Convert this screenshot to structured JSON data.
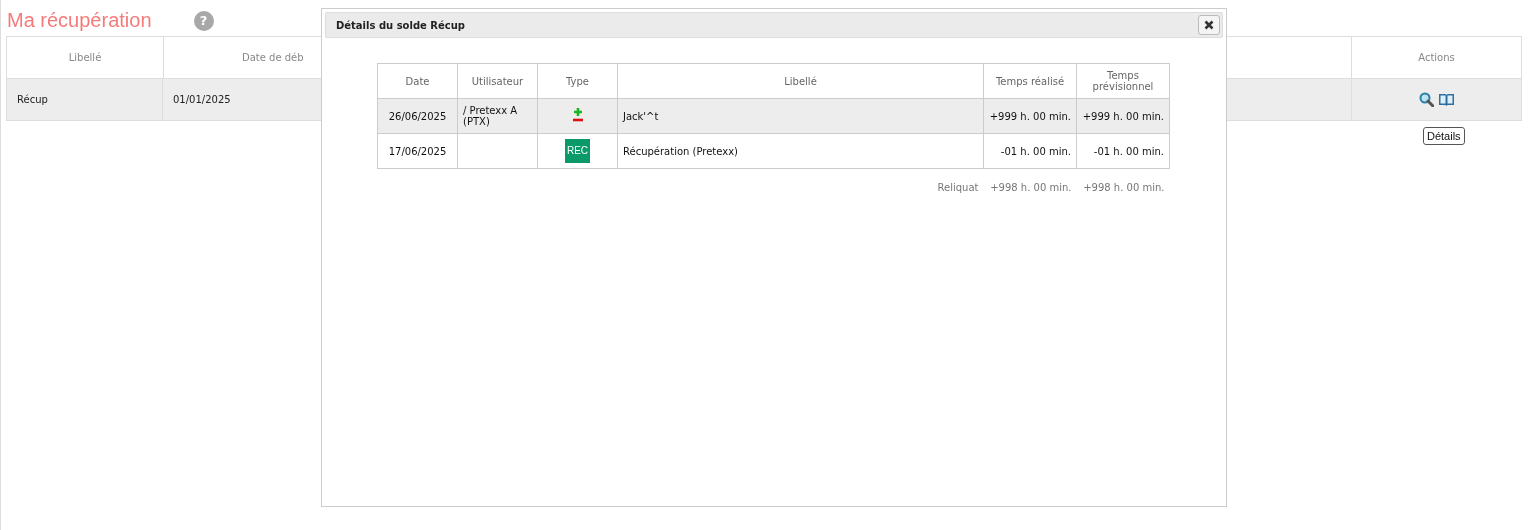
{
  "page": {
    "title": "Ma récupération",
    "help": "?"
  },
  "table": {
    "columns": [
      "Libellé",
      "Date de déb",
      "Actions"
    ],
    "rows": [
      {
        "label": "Récup",
        "date": "01/01/2025",
        "highlighted": true,
        "tooltip": "Détails"
      }
    ]
  },
  "dialog": {
    "title": "Détails du solde Récup",
    "columns": [
      "Date",
      "Utilisateur",
      "Type",
      "Libellé",
      "Temps réalisé",
      "Temps prévisionnel"
    ],
    "rows": [
      {
        "date": "26/06/2025",
        "user": "/ Pretexx A (PTX)",
        "type": {
          "kind": "plusminus"
        },
        "label": "Jack'^t",
        "done": "+999 h. 00 min.",
        "planned": "+999 h. 00 min.",
        "highlighted": true
      },
      {
        "date": "17/06/2025",
        "type": {
          "kind": "badge",
          "text": "REC"
        },
        "label": "Récupération (Pretexx)",
        "done": "-01 h. 00 min.",
        "planned": "-01 h. 00 min.",
        "highlighted": false
      }
    ],
    "footer": {
      "label": "Reliquat",
      "done": "+998 h. 00 min.",
      "planned": "+998 h. 00 min."
    }
  }
}
